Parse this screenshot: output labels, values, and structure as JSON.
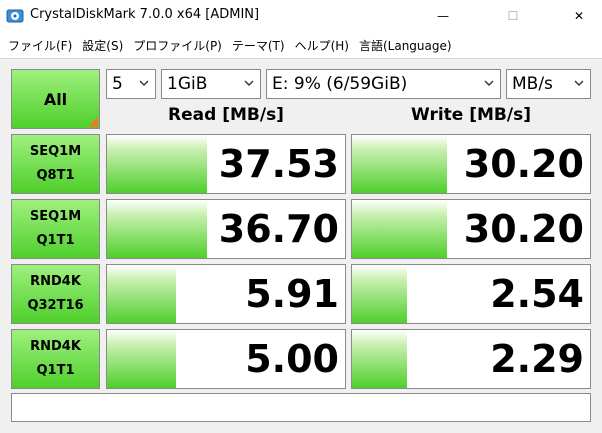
{
  "window": {
    "title": "CrystalDiskMark 7.0.0 x64 [ADMIN]",
    "minimize_glyph": "—",
    "maximize_glyph": "☐",
    "close_glyph": "✕"
  },
  "menu": [
    "ファイル(F)",
    "設定(S)",
    "プロファイル(P)",
    "テーマ(T)",
    "ヘルプ(H)",
    "言語(Language)"
  ],
  "controls": {
    "all_label": "All",
    "count": "5",
    "size": "1GiB",
    "drive": "E: 9% (6/59GiB)",
    "unit": "MB/s"
  },
  "headers": {
    "read": "Read [MB/s]",
    "write": "Write [MB/s]"
  },
  "tests": [
    {
      "line1": "SEQ1M",
      "line2": "Q8T1",
      "read": "37.53",
      "write": "30.20",
      "read_fill": 0.42,
      "write_fill": 0.4
    },
    {
      "line1": "SEQ1M",
      "line2": "Q1T1",
      "read": "36.70",
      "write": "30.20",
      "read_fill": 0.42,
      "write_fill": 0.4
    },
    {
      "line1": "RND4K",
      "line2": "Q32T16",
      "read": "5.91",
      "write": "2.54",
      "read_fill": 0.29,
      "write_fill": 0.23
    },
    {
      "line1": "RND4K",
      "line2": "Q1T1",
      "read": "5.00",
      "write": "2.29",
      "read_fill": 0.29,
      "write_fill": 0.23
    }
  ],
  "comment": "",
  "colors": {
    "accent_green": "#4fcf2c",
    "corner_orange": "#f07a20"
  },
  "icons": {
    "app": "crystaldiskmark-icon",
    "dropdown": "chevron-down-icon"
  }
}
